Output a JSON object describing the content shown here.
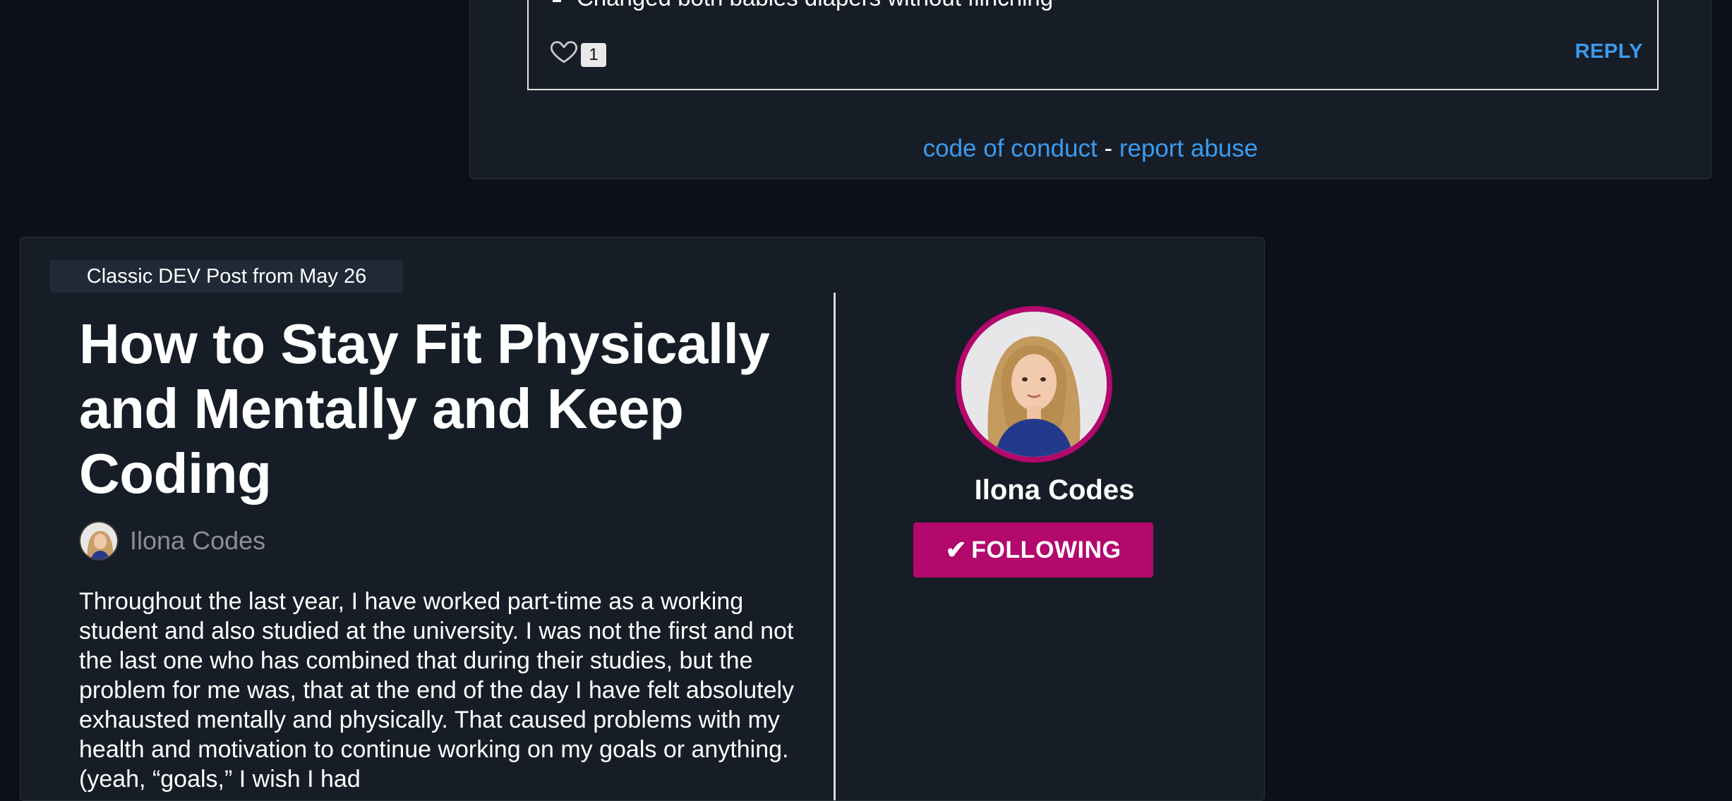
{
  "comment": {
    "bullet_text": "Changed both babies diapers without flinching",
    "like_count": "1",
    "reply_label": "REPLY"
  },
  "footer": {
    "code_of_conduct": "code of conduct",
    "separator": " - ",
    "report_abuse": "report abuse"
  },
  "classic_post": {
    "badge": "Classic DEV Post from May 26",
    "title": "How to Stay Fit Physically and Mentally and Keep Coding",
    "author": "Ilona Codes",
    "body": "Throughout the last year, I have worked part-time as a working student and also studied at the university. I was not the first and not the last one who has combined that during their studies, but the problem for me was, that at the end of the day I have felt absolutely exhausted mentally and physically. That caused problems with my health and motivation to continue working on my goals or anything. (yeah, “goals,” I wish I had"
  },
  "profile": {
    "name": "Ilona Codes",
    "follow_label": "FOLLOWING",
    "follow_icon": "check-icon"
  },
  "colors": {
    "background": "#0d1117",
    "card": "#171d26",
    "link": "#3b9bf0",
    "accent": "#b3086c"
  }
}
